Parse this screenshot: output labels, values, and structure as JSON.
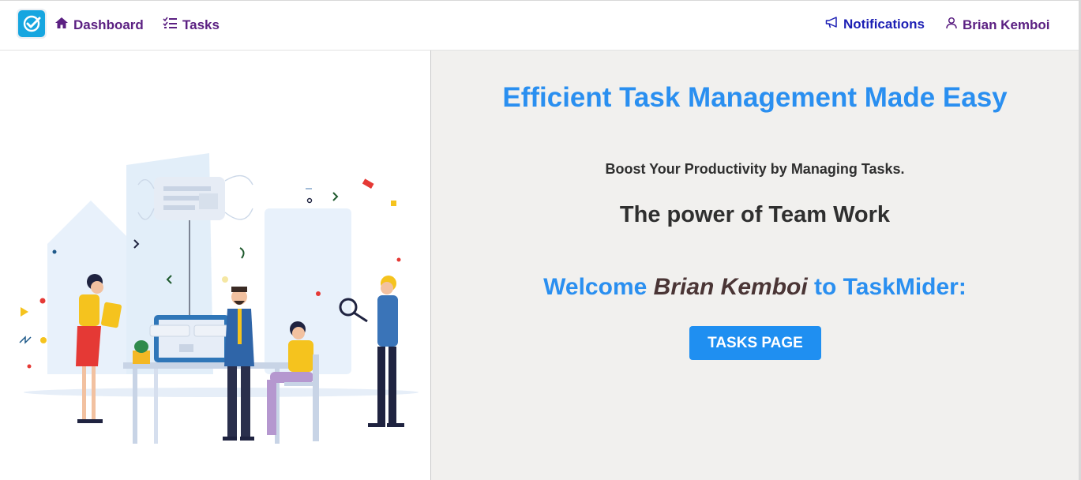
{
  "navbar": {
    "logo_icon": "checkmark-logo-icon",
    "links": {
      "dashboard": "Dashboard",
      "tasks": "Tasks",
      "notifications": "Notifications",
      "user": "Brian Kemboi"
    }
  },
  "hero": {
    "title": "Efficient Task Management Made Easy",
    "subtitle": "Boost Your Productivity by Managing Tasks.",
    "tagline": "The power of Team Work",
    "welcome_prefix": "Welcome",
    "welcome_name": "Brian Kemboi",
    "welcome_suffix": "to TaskMider:",
    "button_label": "TASKS PAGE"
  },
  "colors": {
    "accent_blue": "#2a8ff0",
    "nav_purple": "#5b2082",
    "nav_blue": "#1c1fb4",
    "logo_blue": "#16a6e0",
    "panel_bg": "#f1f0ee"
  },
  "illustration": {
    "icon": "team-work-illustration"
  }
}
